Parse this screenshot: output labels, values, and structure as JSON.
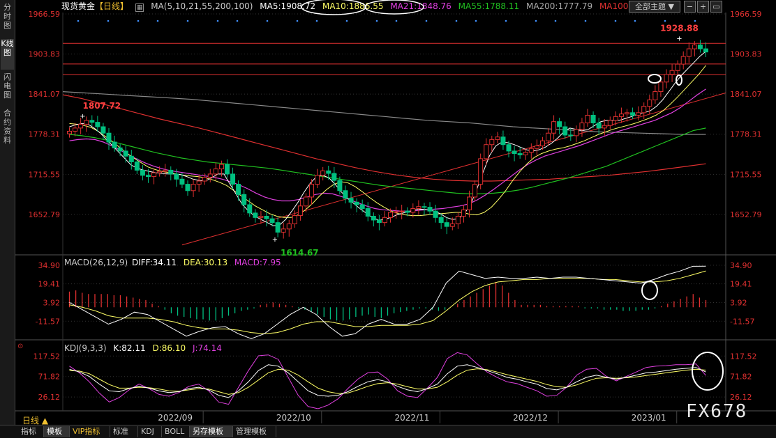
{
  "left_tabs": [
    {
      "label": "分时图",
      "active": false
    },
    {
      "label": "K线图",
      "active": true
    },
    {
      "label": "闪电图",
      "active": false
    },
    {
      "label": "合约资料",
      "active": false
    }
  ],
  "header": {
    "instrument": "现货黄金",
    "period": "【日线】",
    "ma_title": "MA(5,10,21,55,200,100)",
    "ma5": "MA5:1908.72",
    "ma10": "MA10:1886.55",
    "ma21": "MA21:1848.76",
    "ma55": "MA55:1788.11",
    "ma200": "MA200:1777.79",
    "ma100": "MA100",
    "theme_select": "全部主题 ▼"
  },
  "macd": {
    "title": "MACD(26,12,9)",
    "diff": "DIFF:34.11",
    "dea": "DEA:30.13",
    "macd": "MACD:7.95"
  },
  "kdj": {
    "title": "KDJ(9,3,3)",
    "k": "K:82.11",
    "d": "D:86.10",
    "j": "J:74.14"
  },
  "period_selector": "日线 ▲",
  "bottom_tabs": [
    "指标",
    "模板",
    "VIP指标",
    "标准",
    "KDJ",
    "BOLL",
    "另存模板",
    "管理模板"
  ],
  "watermark": "FX678",
  "colors": {
    "up": "#e03030",
    "down": "#00c080",
    "ma5": "#ffffff",
    "ma10": "#ffff66",
    "ma21": "#e040e0",
    "ma55": "#20c020",
    "ma200": "#888888",
    "ma100": "#e03030"
  },
  "chart_data": [
    {
      "type": "candlestick",
      "title": "现货黄金【日线】",
      "x_labels": [
        "2022/09",
        "2022/10",
        "2022/11",
        "2022/12",
        "2023/01"
      ],
      "y_ticks": [
        1652.79,
        1715.55,
        1778.31,
        1841.07,
        1903.83,
        1966.59
      ],
      "ylim": [
        1620,
        1966.59
      ],
      "annotations": [
        {
          "text": "1807.72",
          "value": 1807.72
        },
        {
          "text": "1614.67",
          "value": 1614.67
        },
        {
          "text": "1928.88",
          "value": 1928.88
        }
      ],
      "close_series": [
        1783,
        1788,
        1794,
        1800,
        1797,
        1790,
        1780,
        1766,
        1757,
        1752,
        1744,
        1735,
        1722,
        1714,
        1712,
        1718,
        1720,
        1722,
        1716,
        1708,
        1700,
        1690,
        1700,
        1705,
        1711,
        1716,
        1724,
        1731,
        1716,
        1700,
        1684,
        1668,
        1655,
        1648,
        1650,
        1646,
        1640,
        1625,
        1630,
        1638,
        1651,
        1666,
        1680,
        1700,
        1714,
        1721,
        1717,
        1706,
        1690,
        1678,
        1672,
        1668,
        1662,
        1650,
        1644,
        1640,
        1648,
        1656,
        1657,
        1658,
        1656,
        1662,
        1665,
        1664,
        1658,
        1648,
        1640,
        1634,
        1638,
        1650,
        1660,
        1680,
        1700,
        1740,
        1762,
        1770,
        1774,
        1762,
        1752,
        1748,
        1746,
        1750,
        1756,
        1760,
        1768,
        1780,
        1798,
        1790,
        1777,
        1776,
        1786,
        1796,
        1808,
        1796,
        1788,
        1792,
        1800,
        1806,
        1810,
        1812,
        1808,
        1812,
        1822,
        1832,
        1845,
        1860,
        1872,
        1878,
        1888,
        1900,
        1912,
        1918,
        1912,
        1907
      ],
      "ma5": [
        1790,
        1793,
        1795,
        1794,
        1788,
        1780,
        1770,
        1760,
        1750,
        1740,
        1730,
        1725,
        1722,
        1720,
        1718,
        1717,
        1716,
        1716,
        1715,
        1712,
        1708,
        1706,
        1705,
        1710,
        1716,
        1716,
        1700,
        1684,
        1668,
        1658,
        1650,
        1645,
        1640,
        1635,
        1636,
        1645,
        1658,
        1672,
        1688,
        1702,
        1712,
        1714,
        1710,
        1700,
        1688,
        1678,
        1670,
        1662,
        1655,
        1648,
        1644,
        1645,
        1648,
        1652,
        1655,
        1657,
        1660,
        1661,
        1660,
        1658,
        1654,
        1648,
        1645,
        1646,
        1655,
        1670,
        1694,
        1720,
        1745,
        1760,
        1766,
        1765,
        1762,
        1758,
        1754,
        1752,
        1754,
        1758,
        1764,
        1772,
        1782,
        1788,
        1786,
        1784,
        1786,
        1792,
        1798,
        1800,
        1800,
        1800,
        1803,
        1806,
        1810,
        1812,
        1815,
        1822,
        1832,
        1845,
        1858,
        1870,
        1880,
        1890,
        1900,
        1908
      ],
      "ma10": [
        1795,
        1794,
        1792,
        1789,
        1783,
        1775,
        1767,
        1758,
        1749,
        1741,
        1734,
        1727,
        1723,
        1720,
        1718,
        1716,
        1714,
        1713,
        1712,
        1710,
        1707,
        1703,
        1698,
        1690,
        1682,
        1674,
        1666,
        1660,
        1654,
        1650,
        1648,
        1648,
        1652,
        1660,
        1670,
        1682,
        1692,
        1700,
        1704,
        1702,
        1696,
        1688,
        1679,
        1671,
        1664,
        1658,
        1654,
        1652,
        1651,
        1651,
        1652,
        1653,
        1654,
        1655,
        1656,
        1656,
        1653,
        1652,
        1656,
        1664,
        1676,
        1690,
        1706,
        1720,
        1732,
        1742,
        1748,
        1752,
        1755,
        1757,
        1760,
        1764,
        1768,
        1773,
        1778,
        1782,
        1786,
        1789,
        1792,
        1795,
        1799,
        1803,
        1808,
        1815,
        1825,
        1836,
        1848,
        1860,
        1872,
        1886
      ],
      "ma21": [
        1768,
        1770,
        1771,
        1770,
        1766,
        1760,
        1753,
        1746,
        1739,
        1733,
        1728,
        1724,
        1721,
        1719,
        1717,
        1715,
        1713,
        1711,
        1708,
        1704,
        1699,
        1693,
        1686,
        1680,
        1676,
        1674,
        1674,
        1676,
        1680,
        1684,
        1686,
        1685,
        1681,
        1676,
        1671,
        1666,
        1662,
        1660,
        1659,
        1658,
        1658,
        1659,
        1660,
        1661,
        1662,
        1664,
        1666,
        1669,
        1675,
        1683,
        1692,
        1702,
        1712,
        1722,
        1731,
        1738,
        1744,
        1748,
        1752,
        1756,
        1760,
        1765,
        1770,
        1775,
        1780,
        1784,
        1788,
        1792,
        1796,
        1800,
        1806,
        1812,
        1820,
        1830,
        1840,
        1849
      ],
      "ma55": [
        1778,
        1776,
        1773,
        1769,
        1764,
        1759,
        1754,
        1749,
        1745,
        1741,
        1738,
        1735,
        1733,
        1731,
        1729,
        1727,
        1725,
        1722,
        1719,
        1716,
        1713,
        1710,
        1707,
        1704,
        1701,
        1698,
        1696,
        1694,
        1692,
        1690,
        1688,
        1686,
        1685,
        1685,
        1686,
        1688,
        1691,
        1695,
        1700,
        1705,
        1710,
        1716,
        1722,
        1728,
        1736,
        1744,
        1752,
        1760,
        1768,
        1776,
        1784,
        1788
      ],
      "ma200": [
        1845,
        1843,
        1841,
        1839,
        1837,
        1835,
        1833,
        1830,
        1827,
        1824,
        1821,
        1818,
        1815,
        1812,
        1809,
        1806,
        1803,
        1800,
        1798,
        1796,
        1793,
        1790,
        1788,
        1786,
        1784,
        1782,
        1781,
        1780,
        1779,
        1778,
        1778
      ],
      "ma100": [
        1840,
        1834,
        1826,
        1818,
        1810,
        1802,
        1795,
        1788,
        1780,
        1772,
        1764,
        1756,
        1748,
        1740,
        1733,
        1726,
        1720,
        1715,
        1711,
        1708,
        1706,
        1705,
        1705,
        1706,
        1707,
        1708,
        1710,
        1712,
        1714,
        1717,
        1720,
        1724,
        1728,
        1732
      ],
      "trendline": [
        [
          0,
          1605
        ],
        [
          1,
          1843
        ]
      ],
      "hlines": [
        1920.5,
        1888.2,
        1871.5
      ]
    },
    {
      "type": "macd",
      "title": "MACD(26,12,9)",
      "y_ticks": [
        -11.57,
        3.92,
        19.41,
        34.9
      ],
      "ylim": [
        -27,
        40
      ],
      "diff": [
        4,
        -2,
        -8,
        -14,
        -10,
        -4,
        -6,
        -12,
        -18,
        -24,
        -20,
        -17,
        -16,
        -22,
        -26,
        -22,
        -14,
        -6,
        0,
        -6,
        -16,
        -24,
        -22,
        -14,
        -10,
        -14,
        -14,
        -10,
        0,
        20,
        30,
        27,
        24,
        25,
        24,
        24,
        25,
        24,
        25,
        25,
        24,
        23,
        22,
        21,
        20,
        23,
        27,
        30,
        34,
        34.11
      ],
      "dea": [
        2,
        0,
        -3,
        -7,
        -9,
        -9,
        -9,
        -10,
        -12,
        -15,
        -17,
        -18,
        -18,
        -19,
        -21,
        -22,
        -21,
        -18,
        -14,
        -12,
        -12,
        -14,
        -16,
        -16,
        -15,
        -15,
        -15,
        -14,
        -11,
        -3,
        6,
        13,
        18,
        21,
        22,
        23,
        23,
        24,
        24,
        24,
        24,
        23,
        23,
        22,
        21,
        21,
        22,
        24,
        27,
        30.13
      ],
      "hist": [
        13,
        14,
        12,
        11,
        11,
        11,
        11,
        10,
        10,
        9,
        8,
        7,
        6,
        3,
        1,
        -2,
        -5,
        -7,
        -8,
        -9,
        -10,
        -10,
        -11,
        -11,
        -9,
        -7,
        -5,
        -3,
        -2,
        -1,
        2,
        3,
        4,
        3,
        2,
        1,
        -1,
        -2,
        -4,
        -6,
        -8,
        -10,
        -11,
        -11,
        -10,
        -8,
        -7,
        -6,
        -8,
        -9,
        -7,
        -5,
        -4,
        -3,
        -2,
        -1,
        -1,
        -2,
        -3,
        -2,
        0,
        3,
        6,
        9,
        12,
        15,
        18,
        21,
        18,
        12,
        6,
        2,
        2,
        2,
        2,
        1,
        1,
        1,
        1,
        1,
        1,
        -1,
        -1,
        -1,
        -2,
        -2,
        -2,
        -3,
        -3,
        -3,
        -2,
        -2,
        -1,
        1,
        3,
        5,
        7,
        9,
        11,
        8,
        6
      ]
    },
    {
      "type": "kdj",
      "title": "KDJ(9,3,3)",
      "y_ticks": [
        26.12,
        71.82,
        117.52
      ],
      "ylim": [
        0,
        135
      ],
      "k": [
        88,
        82,
        72,
        55,
        40,
        38,
        45,
        50,
        46,
        40,
        36,
        38,
        45,
        48,
        42,
        30,
        25,
        40,
        60,
        85,
        98,
        95,
        80,
        60,
        40,
        30,
        28,
        30,
        38,
        50,
        60,
        65,
        60,
        50,
        42,
        38,
        45,
        55,
        78,
        95,
        98,
        92,
        85,
        78,
        70,
        66,
        60,
        55,
        45,
        42,
        48,
        60,
        70,
        75,
        70,
        66,
        70,
        75,
        80,
        82,
        85,
        88,
        90,
        92,
        82
      ],
      "d": [
        85,
        84,
        78,
        66,
        54,
        46,
        46,
        48,
        47,
        44,
        40,
        39,
        42,
        45,
        44,
        38,
        32,
        36,
        48,
        64,
        80,
        88,
        86,
        75,
        60,
        46,
        38,
        34,
        35,
        42,
        50,
        56,
        58,
        55,
        49,
        44,
        44,
        48,
        60,
        75,
        86,
        89,
        87,
        82,
        76,
        71,
        66,
        61,
        54,
        49,
        48,
        53,
        61,
        68,
        69,
        68,
        69,
        71,
        74,
        77,
        80,
        83,
        86,
        88,
        86.1
      ],
      "j": [
        95,
        80,
        60,
        35,
        15,
        25,
        42,
        55,
        45,
        32,
        28,
        36,
        50,
        55,
        40,
        15,
        10,
        48,
        85,
        118,
        120,
        110,
        70,
        30,
        5,
        0,
        8,
        22,
        45,
        66,
        80,
        82,
        66,
        40,
        28,
        25,
        46,
        70,
        112,
        125,
        120,
        100,
        82,
        70,
        60,
        56,
        48,
        40,
        28,
        30,
        48,
        75,
        88,
        90,
        72,
        62,
        72,
        82,
        92,
        95,
        96,
        98,
        98,
        100,
        74.14
      ]
    }
  ]
}
